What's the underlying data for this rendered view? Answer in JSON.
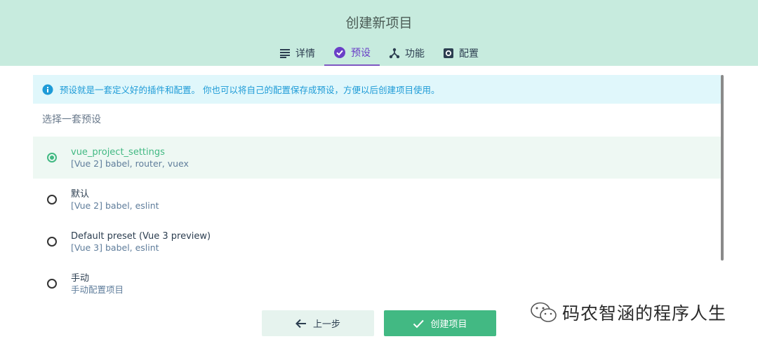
{
  "header": {
    "title": "创建新项目",
    "tabs": [
      {
        "label": "详情",
        "icon": "list-icon"
      },
      {
        "label": "预设",
        "icon": "check-circle-icon"
      },
      {
        "label": "功能",
        "icon": "fork-icon"
      },
      {
        "label": "配置",
        "icon": "gear-icon"
      }
    ],
    "active_tab": "预设"
  },
  "info": {
    "text": "预设就是一套定义好的插件和配置。 你也可以将自己的配置保存成预设，方便以后创建项目使用。",
    "icon": "info-icon"
  },
  "section_title": "选择一套预设",
  "presets": [
    {
      "name": "vue_project_settings",
      "desc": "[Vue 2] babel, router, vuex",
      "selected": true
    },
    {
      "name": "默认",
      "desc": "[Vue 2] babel, eslint",
      "selected": false
    },
    {
      "name": "Default preset (Vue 3 preview)",
      "desc": "[Vue 3] babel, eslint",
      "selected": false
    },
    {
      "name": "手动",
      "desc": "手动配置项目",
      "selected": false
    }
  ],
  "buttons": {
    "prev": {
      "label": "上一步",
      "icon": "arrow-left-icon"
    },
    "create": {
      "label": "创建项目",
      "icon": "checkmark-icon"
    }
  },
  "watermark": {
    "text": "码农智涵的程序人生",
    "icon": "wechat-icon"
  },
  "colors": {
    "header_bg": "#c7ebde",
    "accent": "#42b983",
    "active_tab": "#7e57c2",
    "info_bg": "#e0f7fb",
    "info_text": "#1e9bd7"
  }
}
